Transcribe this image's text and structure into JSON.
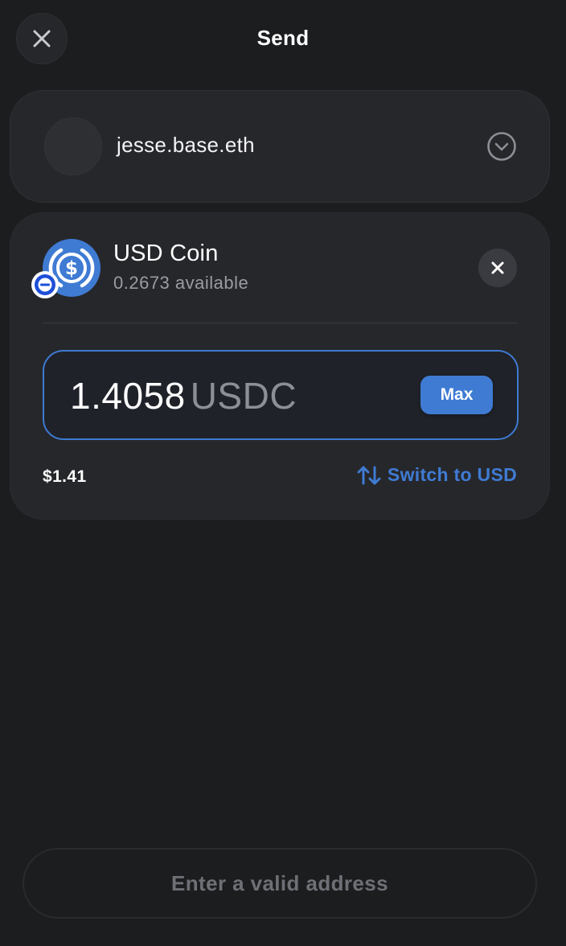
{
  "header": {
    "title": "Send",
    "close_icon": "close-icon"
  },
  "recipient": {
    "name": "jesse.base.eth",
    "chevron_icon": "chevron-down-circle-icon"
  },
  "asset": {
    "name": "USD Coin",
    "available": "0.2673 available",
    "icon": "usdc-coin-icon",
    "badge_icon": "minus-badge-icon",
    "remove_icon": "close-icon"
  },
  "amount": {
    "value": "1.4058",
    "unit": "USDC",
    "max_label": "Max",
    "fiat_value": "$1.41",
    "switch_label": "Switch to USD",
    "switch_icon": "swap-vertical-icon"
  },
  "footer": {
    "submit_label": "Enter a valid address"
  },
  "colors": {
    "background": "#1c1d1f",
    "card": "#26272b",
    "accent": "#3f7bd3",
    "muted_text": "#9a9ba3"
  }
}
